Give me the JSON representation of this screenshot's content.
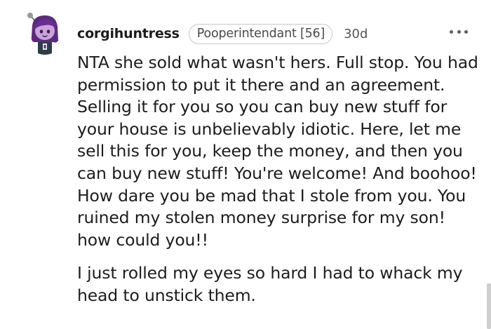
{
  "comment": {
    "author": {
      "username": "corgihuntress",
      "flair": "Pooperintendant [56]",
      "avatar": "snoo-avatar-purple-hair"
    },
    "timestamp": "30d",
    "more_icon": "more-horizontal-icon",
    "paragraphs": [
      "NTA she sold what wasn't hers. Full stop. You had permission to put it there and an agreement. Selling it for you so you can buy new stuff for your house is unbelievably idiotic. Here, let me sell this for you, keep the money, and then you can buy new stuff! You're welcome! And boohoo! How dare you be mad that I stole from you. You ruined my stolen money surprise for my son! how could you!!",
      "I just rolled my eyes so hard I had to whack my head to unstick them."
    ]
  },
  "colors": {
    "avatar_hair": "#6a2d8f",
    "avatar_face": "#c9a3d9",
    "text": "#1c1c1c",
    "flair_border": "#c8c8c8"
  }
}
